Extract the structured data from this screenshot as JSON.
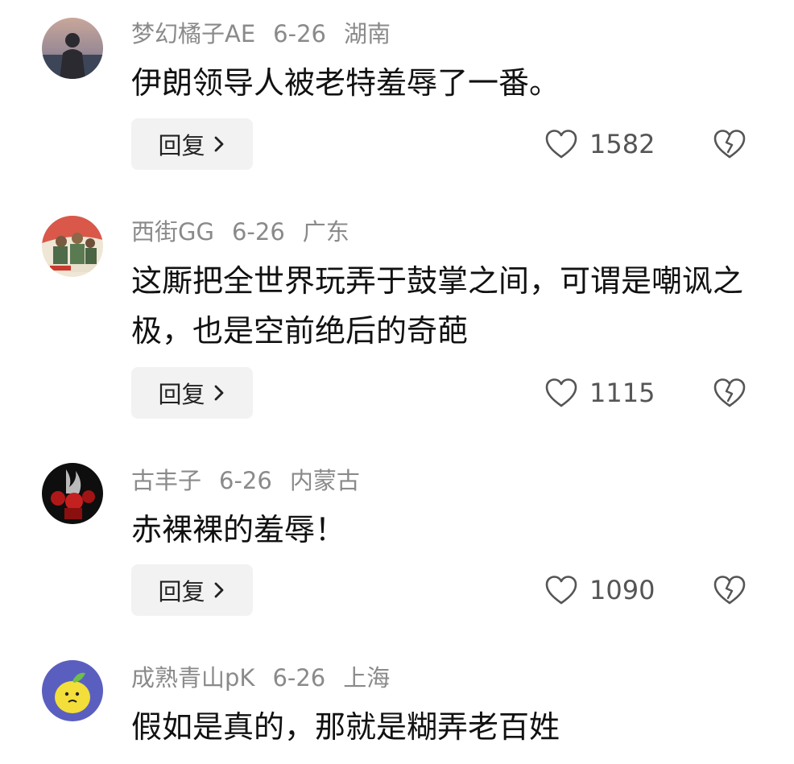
{
  "ui": {
    "reply_label": "回复",
    "colors": {
      "meta": "#8a8a8a",
      "text": "#111111",
      "reply_bg": "#f2f2f2",
      "icon": "#555555"
    },
    "icons": {
      "reply_chevron": "chevron-right-icon",
      "like": "heart-outline-icon",
      "dislike": "broken-heart-icon"
    }
  },
  "comments": [
    {
      "username": "梦幻橘子AE",
      "date": "6-26",
      "location": "湖南",
      "text": "伊朗领导人被老特羞辱了一番。",
      "likes": "1582"
    },
    {
      "username": "西街GG",
      "date": "6-26",
      "location": "广东",
      "text": "这厮把全世界玩弄于鼓掌之间，可谓是嘲讽之极，也是空前绝后的奇葩",
      "likes": "1115"
    },
    {
      "username": "古丰子",
      "date": "6-26",
      "location": "内蒙古",
      "text": "赤裸裸的羞辱！",
      "likes": "1090"
    },
    {
      "username": "成熟青山pK",
      "date": "6-26",
      "location": "上海",
      "text": "假如是真的，那就是糊弄老百姓",
      "likes": ""
    }
  ]
}
